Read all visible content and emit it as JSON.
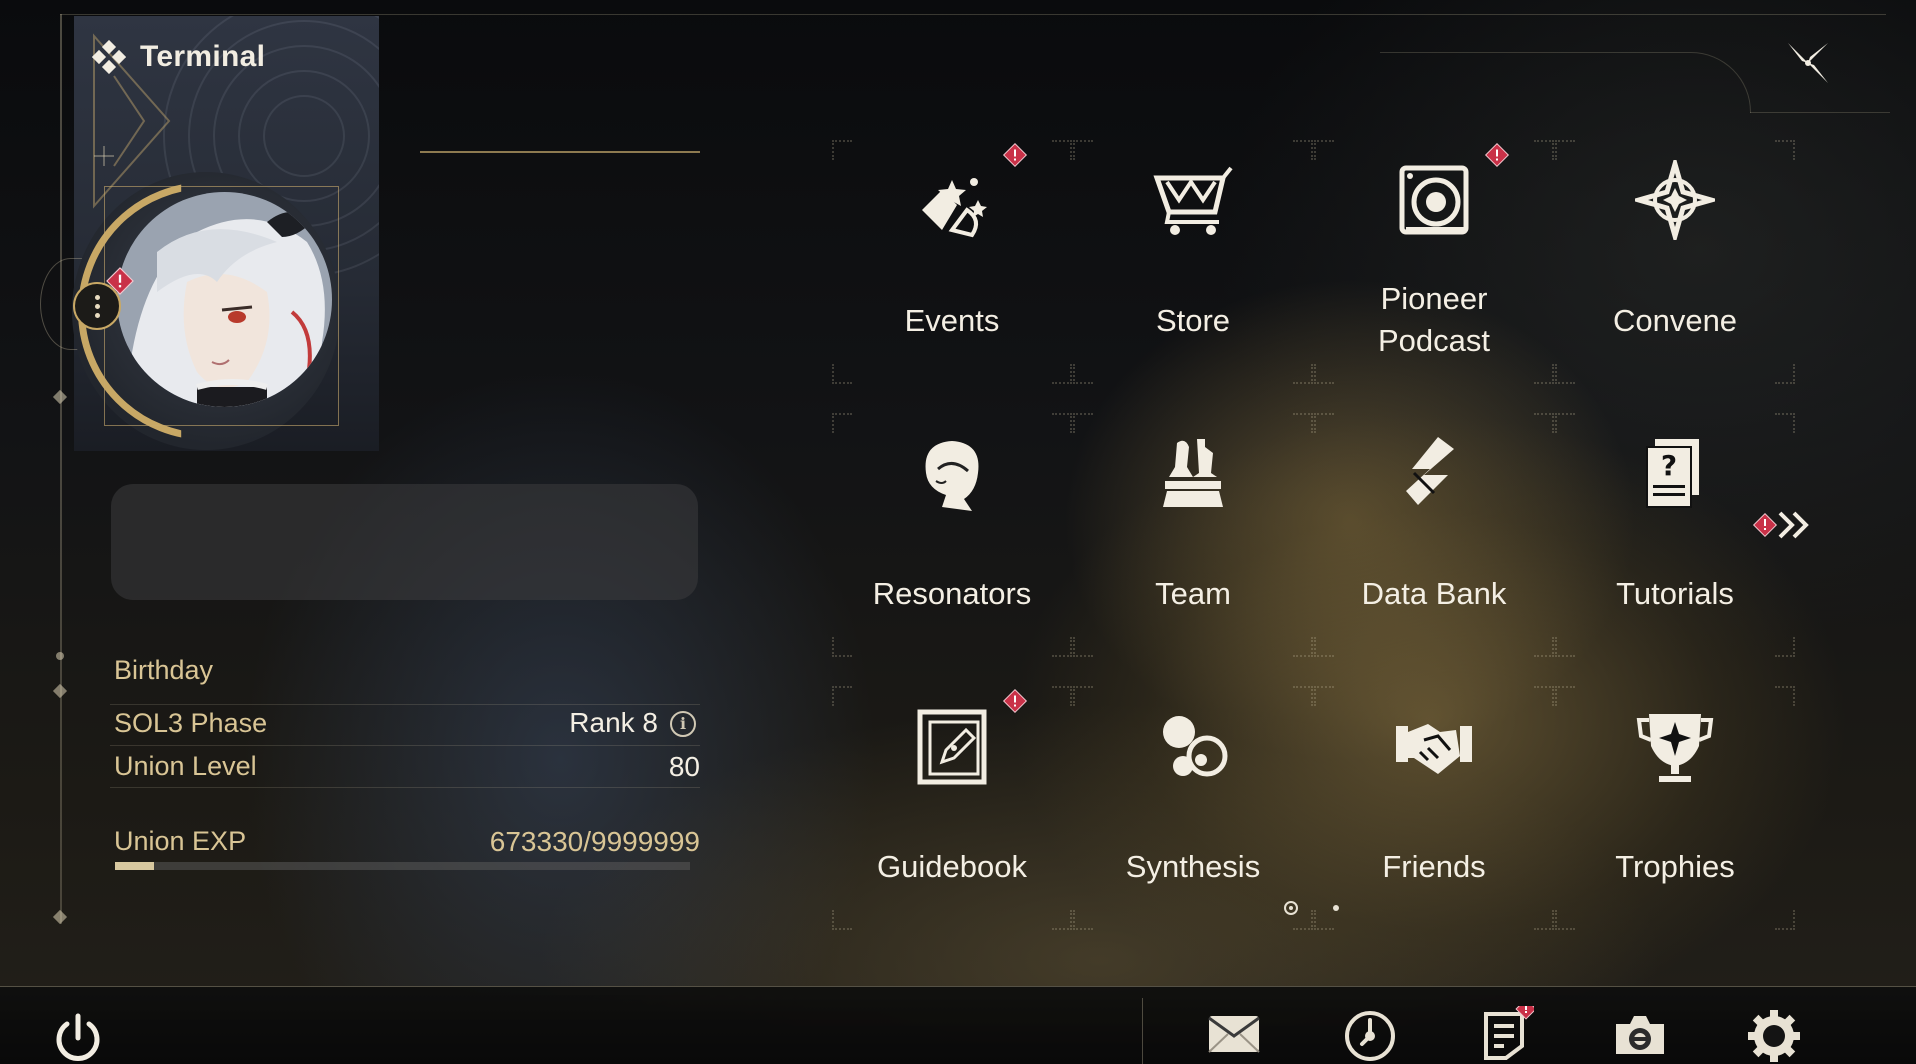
{
  "window": {
    "title": "Terminal"
  },
  "profile": {
    "name": "",
    "signature_placeholder": "",
    "stats": {
      "birthday_label": "Birthday",
      "birthday_value": "",
      "phase_label": "SOL3 Phase",
      "phase_value": "Rank 8",
      "union_level_label": "Union Level",
      "union_level_value": "80",
      "union_exp_label": "Union EXP",
      "union_exp_value": "673330/9999999",
      "union_exp_progress": 0.067
    }
  },
  "menu": {
    "items": [
      {
        "label": "Events",
        "icon": "events-icon",
        "badge": true
      },
      {
        "label": "Store",
        "icon": "cart-icon",
        "badge": false
      },
      {
        "label": "Pioneer\nPodcast",
        "icon": "podcast-icon",
        "badge": true
      },
      {
        "label": "Convene",
        "icon": "convene-icon",
        "badge": false
      },
      {
        "label": "Resonators",
        "icon": "resonator-icon",
        "badge": false
      },
      {
        "label": "Team",
        "icon": "chess-icon",
        "badge": false
      },
      {
        "label": "Data Bank",
        "icon": "databank-icon",
        "badge": false
      },
      {
        "label": "Tutorials",
        "icon": "tutorial-icon",
        "badge": false
      },
      {
        "label": "Guidebook",
        "icon": "guidebook-icon",
        "badge": true
      },
      {
        "label": "Synthesis",
        "icon": "synthesis-icon",
        "badge": false
      },
      {
        "label": "Friends",
        "icon": "handshake-icon",
        "badge": false
      },
      {
        "label": "Trophies",
        "icon": "trophy-icon",
        "badge": false
      }
    ],
    "page_count": 2,
    "current_page": 1
  },
  "bottom_bar": {
    "buttons": [
      "mail-icon",
      "clock-icon",
      "notice-icon",
      "camera-icon",
      "settings-icon"
    ]
  },
  "colors": {
    "accent_gold": "#c8a865",
    "text_gold": "#d9c595",
    "badge_red": "#c93148",
    "text_light": "#f4efe4"
  }
}
